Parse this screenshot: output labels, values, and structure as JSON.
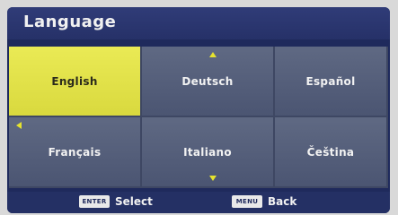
{
  "header": {
    "title": "Language"
  },
  "languages": [
    {
      "label": "English",
      "selected": true
    },
    {
      "label": "Deutsch",
      "selected": false
    },
    {
      "label": "Español",
      "selected": false
    },
    {
      "label": "Français",
      "selected": false
    },
    {
      "label": "Italiano",
      "selected": false
    },
    {
      "label": "Čeština",
      "selected": false
    }
  ],
  "nav_arrows": [
    "arrow-up-icon",
    "arrow-down-icon",
    "arrow-left-icon",
    "arrow-right-icon"
  ],
  "footer": {
    "select_key": "ENTER",
    "select_label": "Select",
    "back_key": "MENU",
    "back_label": "Back"
  },
  "colors": {
    "background": "#1f2a5c",
    "tile": "#5a6480",
    "selected_tile": "#e3e24a",
    "arrow": "#e6e32e",
    "text": "#f2f2f2"
  }
}
